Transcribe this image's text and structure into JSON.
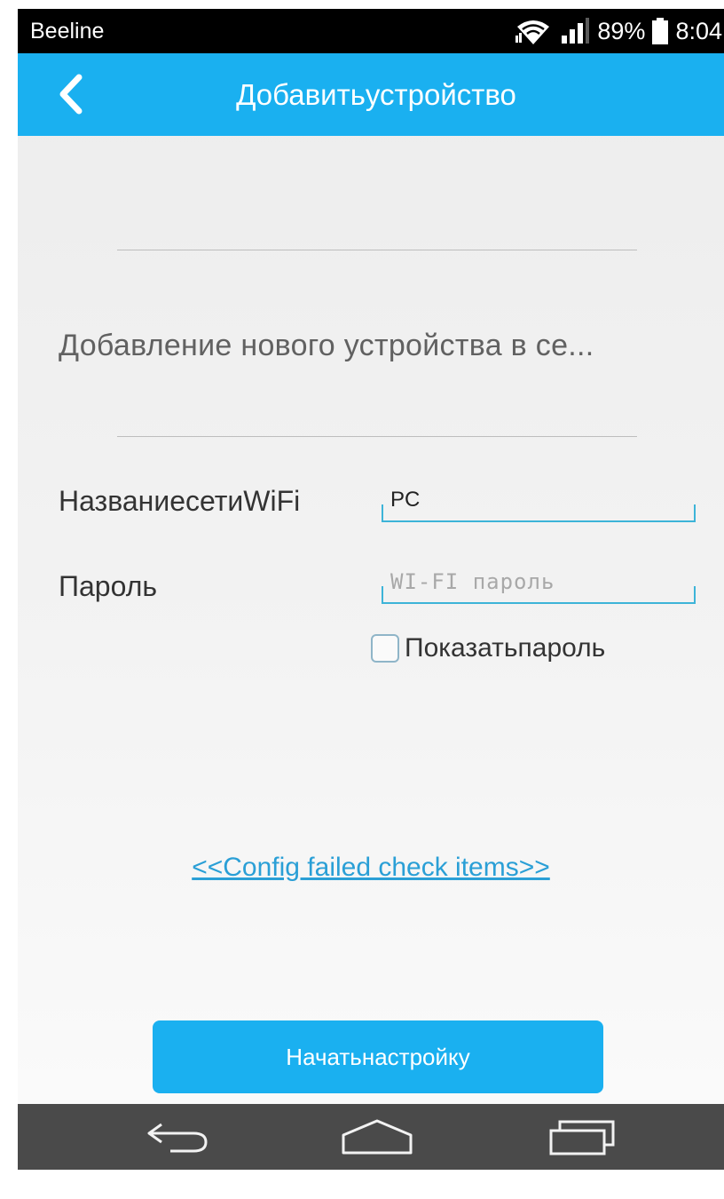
{
  "status_bar": {
    "carrier": "Beeline",
    "battery_percent": "89%",
    "time": "8:04",
    "icons": [
      "wifi-icon",
      "signal-icon",
      "battery-icon"
    ]
  },
  "app_bar": {
    "title": "Добавитьустройство",
    "back_icon": "chevron-left-icon"
  },
  "content": {
    "intro_text": "Добавление нового устройства в се...",
    "wifi_label": "НазваниесетиWiFi",
    "wifi_value": "PC",
    "password_label": "Пароль",
    "password_placeholder": "WI-FI пароль",
    "password_value": "",
    "show_password_label": "Показатьпароль",
    "show_password_checked": false,
    "config_link": "<<Config failed check items>>",
    "start_button": "Начатьнастройку"
  },
  "nav_bar": {
    "icons": [
      "back-arrow-icon",
      "home-icon",
      "recent-apps-icon"
    ]
  },
  "colors": {
    "accent": "#1ab0f0",
    "link": "#2a9fd6",
    "status_bar": "#000000",
    "nav_bar": "#4a4a4a",
    "field_line": "#3db4d8"
  }
}
